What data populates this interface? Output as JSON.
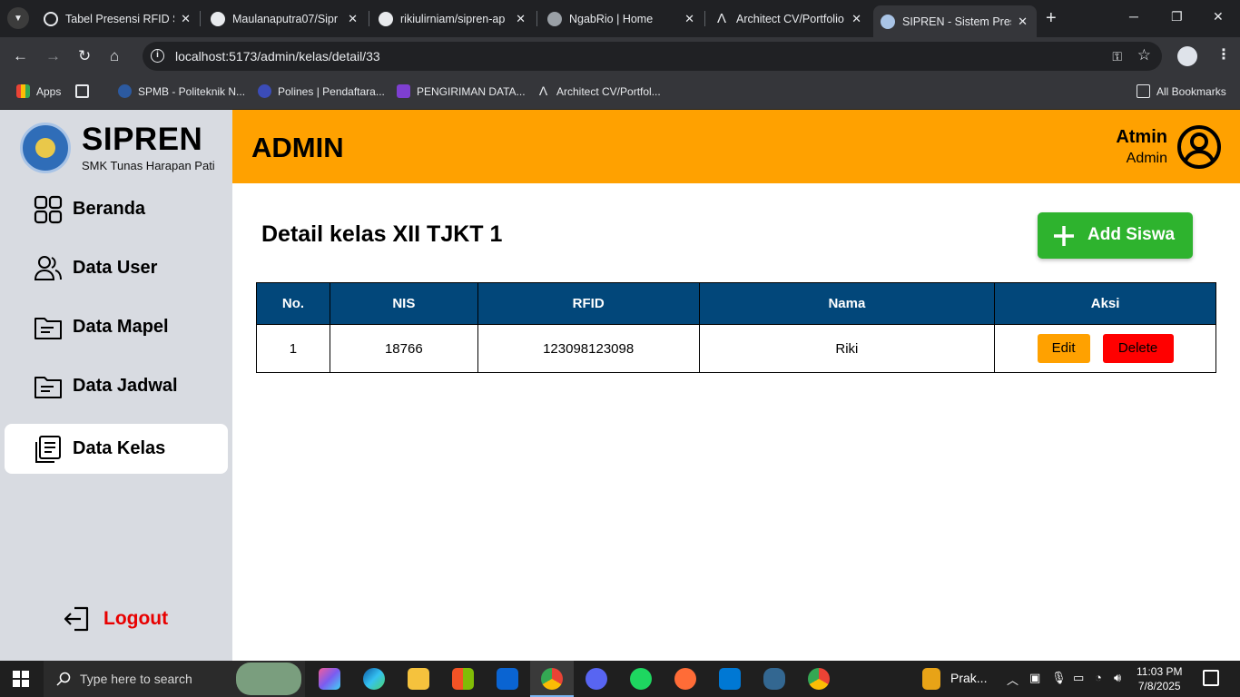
{
  "browser": {
    "tabs": [
      {
        "label": "Tabel Presensi RFID Si",
        "icon_color": "#e8eaed"
      },
      {
        "label": "Maulanaputra07/Sipr",
        "icon_color": "#e8eaed"
      },
      {
        "label": "rikiulirniam/sipren-ap",
        "icon_color": "#e8eaed"
      },
      {
        "label": "NgabRio | Home",
        "icon_color": "#e8eaed"
      },
      {
        "label": "Architect CV/Portfolio",
        "icon_color": "#e8eaed"
      },
      {
        "label": "SIPREN - Sistem Prese",
        "icon_color": "#a9c4e6"
      }
    ],
    "url": "localhost:5173/admin/kelas/detail/33",
    "bookmarks": [
      {
        "label": "Apps"
      },
      {
        "label": "SPMB - Politeknik N..."
      },
      {
        "label": "Polines | Pendaftara..."
      },
      {
        "label": "PENGIRIMAN DATA..."
      },
      {
        "label": "Architect CV/Portfol..."
      }
    ],
    "all_bookmarks": "All Bookmarks"
  },
  "sidebar": {
    "brand_name": "SIPREN",
    "brand_sub": "SMK Tunas Harapan Pati",
    "items": [
      {
        "label": "Beranda",
        "icon": "grid-icon"
      },
      {
        "label": "Data User",
        "icon": "users-icon"
      },
      {
        "label": "Data Mapel",
        "icon": "folder-icon"
      },
      {
        "label": "Data Jadwal",
        "icon": "folder-icon"
      },
      {
        "label": "Data Kelas",
        "icon": "document-icon"
      }
    ],
    "logout": "Logout"
  },
  "header": {
    "role_title": "ADMIN",
    "user_name": "Atmin",
    "user_role": "Admin"
  },
  "main": {
    "title": "Detail kelas XII TJKT 1",
    "add_button": "Add Siswa",
    "table": {
      "headers": [
        "No.",
        "NIS",
        "RFID",
        "Nama",
        "Aksi"
      ],
      "rows": [
        {
          "no": "1",
          "nis": "18766",
          "rfid": "123098123098",
          "nama": "Riki"
        }
      ],
      "edit_label": "Edit",
      "delete_label": "Delete"
    }
  },
  "taskbar": {
    "search_placeholder": "Type here to search",
    "tray_app_label": "Prak...",
    "time": "11:03 PM",
    "date": "7/8/2025"
  },
  "colors": {
    "header_bg": "#ffa100",
    "sidebar_bg": "#d8dbe1",
    "table_header_bg": "#02477a",
    "add_button_bg": "#2eb32e",
    "edit_button_bg": "#ffa100",
    "delete_button_bg": "#ff0000",
    "logout_text": "#e80000"
  }
}
